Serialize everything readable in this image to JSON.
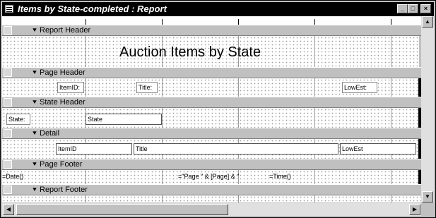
{
  "window": {
    "title": "Items by State-completed : Report",
    "minimize_symbol": "_",
    "maximize_symbol": "□",
    "close_symbol": "×"
  },
  "sections": {
    "report_header": "Report Header",
    "page_header": "Page Header",
    "state_header": "State Header",
    "detail": "Detail",
    "page_footer": "Page Footer",
    "report_footer": "Report Footer"
  },
  "section_marker": "⯆",
  "controls": {
    "report_title": "Auction Items by State",
    "page_header_labels": [
      "ItemID:",
      "Title:",
      "LowEst:"
    ],
    "state_label": "State:",
    "state_field": "State",
    "detail_fields": [
      "ItemID",
      "Title",
      "LowEst"
    ],
    "footer_date": "=Date()",
    "footer_page": "=\"Page \" & [Page] & \"",
    "footer_time": "=Time()"
  },
  "scrollbars": {
    "up_arrow": "▲",
    "down_arrow": "▼",
    "left_arrow": "◀",
    "right_arrow": "▶"
  },
  "icons": [
    "report-window-icon",
    "section-marker-icon"
  ]
}
